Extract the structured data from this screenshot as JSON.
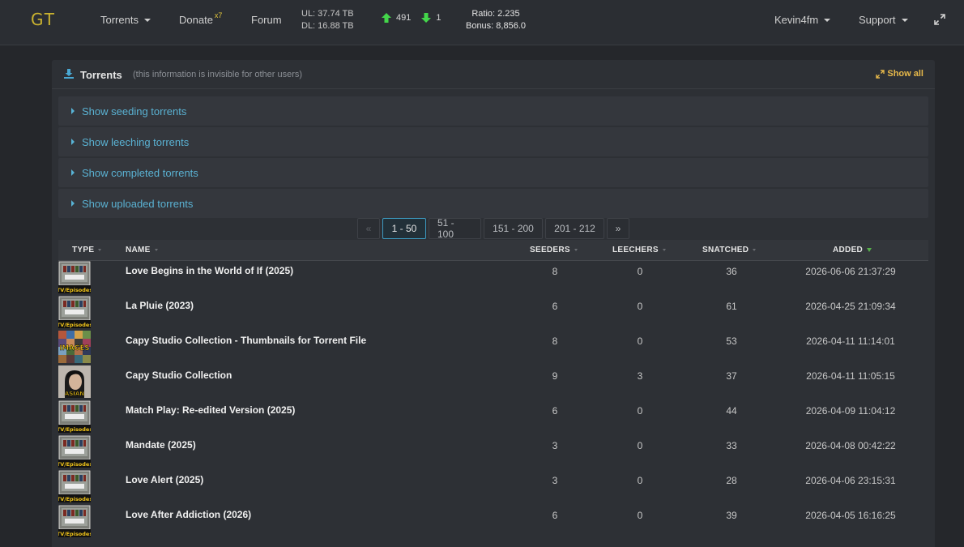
{
  "topbar": {
    "logo": "GT",
    "nav_torrents": "Torrents",
    "nav_donate": "Donate",
    "donate_badge": "x7",
    "nav_forum": "Forum",
    "ul": "UL: 37.74 TB",
    "dl": "DL: 16.88 TB",
    "seeding_count": "491",
    "leeching_count": "1",
    "ratio": "Ratio: 2.235",
    "bonus": "Bonus: 8,856.0",
    "user": "Kevin4fm",
    "support": "Support",
    "colors": {
      "logo": "#c9b22f",
      "up_arrow": "#43d64a",
      "down_arrow": "#43d64a"
    }
  },
  "panel": {
    "title": "Torrents",
    "note": "(this information is invisible for other users)",
    "show_all": "Show all",
    "sections": [
      "Show seeding torrents",
      "Show leeching torrents",
      "Show completed torrents",
      "Show uploaded torrents"
    ]
  },
  "pagination": {
    "prev": "«",
    "pages": [
      "1 - 50",
      "51 - 100",
      "151 - 200",
      "201 - 212"
    ],
    "next": "»",
    "active_page": "1 - 50"
  },
  "table": {
    "headers": {
      "type": "TYPE",
      "name": "NAME",
      "seeders": "SEEDERS",
      "leechers": "LEECHERS",
      "snatched": "SNATCHED",
      "added": "ADDED"
    },
    "rows": [
      {
        "type": "TV/Episodes",
        "name": "Love Begins in the World of If (2025)",
        "seeders": "8",
        "leechers": "0",
        "snatched": "36",
        "added": "2026-06-06 21:37:29"
      },
      {
        "type": "TV/Episodes",
        "name": "La Pluie (2023)",
        "seeders": "6",
        "leechers": "0",
        "snatched": "61",
        "added": "2026-04-25 21:09:34"
      },
      {
        "type": "Images",
        "name": "Capy Studio Collection - Thumbnails for Torrent File",
        "seeders": "8",
        "leechers": "0",
        "snatched": "53",
        "added": "2026-04-11 11:14:01"
      },
      {
        "type": "Asian",
        "name": "Capy Studio Collection",
        "seeders": "9",
        "leechers": "3",
        "snatched": "37",
        "added": "2026-04-11 11:05:15"
      },
      {
        "type": "TV/Episodes",
        "name": "Match Play: Re-edited Version (2025)",
        "seeders": "6",
        "leechers": "0",
        "snatched": "44",
        "added": "2026-04-09 11:04:12"
      },
      {
        "type": "TV/Episodes",
        "name": "Mandate (2025)",
        "seeders": "3",
        "leechers": "0",
        "snatched": "33",
        "added": "2026-04-08 00:42:22"
      },
      {
        "type": "TV/Episodes",
        "name": "Love Alert (2025)",
        "seeders": "3",
        "leechers": "0",
        "snatched": "28",
        "added": "2026-04-06 23:15:31"
      },
      {
        "type": "TV/Episodes",
        "name": "Love After Addiction (2026)",
        "seeders": "6",
        "leechers": "0",
        "snatched": "39",
        "added": "2026-04-05 16:16:25"
      }
    ]
  }
}
